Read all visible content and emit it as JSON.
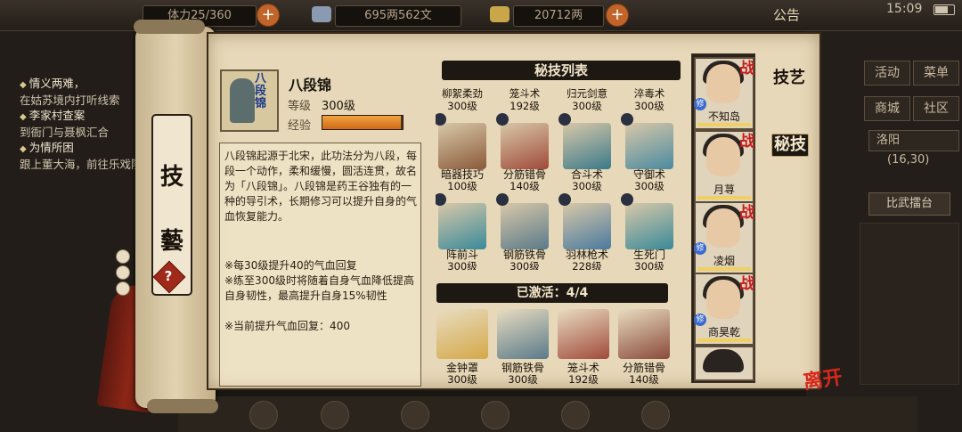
{
  "topbar": {
    "stamina": "体力25/360",
    "silver": "695两562文",
    "gold": "20712两",
    "announcement": "公告",
    "time": "15:09"
  },
  "quests": [
    {
      "title": "情义两难，",
      "desc": "在姑苏境内打听线索"
    },
    {
      "title": "李家村查案",
      "desc": "到衙门与聂枫汇合"
    },
    {
      "title": "为情所困",
      "desc": "跟上董大海，前往乐戏院"
    }
  ],
  "right_menu": {
    "activity": "活动",
    "menu": "菜单",
    "shop": "商城",
    "community": "社区",
    "location": "洛阳",
    "coords": "(16,30)",
    "arena": "比武擂台"
  },
  "scroll": {
    "char1": "技",
    "char2": "藝",
    "help": "?"
  },
  "skill": {
    "portrait_text": "八段锦",
    "name": "八段锦",
    "level_label": "等级",
    "level_value": "300级",
    "exp_label": "经验",
    "exp_fraction": 1.0,
    "description": "八段锦起源于北宋，此功法分为八段，每段一个动作，柔和缓慢，圆活连贯，故名为「八段锦」。八段锦是药王谷独有的一种的导引术，长期修习可以提升自身的气血恢复能力。",
    "note1": "※每30级提升40的气血回复",
    "note2": "※练至300级时将随着自身气血降低提高自身韧性，最高提升自身15%韧性",
    "note3": "※当前提升气血回复：400"
  },
  "list": {
    "title": "秘技列表",
    "partial_top": [
      {
        "name": "柳絮柔劲",
        "level": "300级"
      },
      {
        "name": "笼斗术",
        "level": "192级"
      },
      {
        "name": "归元剑意",
        "level": "300级"
      },
      {
        "name": "淬毒术",
        "level": "300级"
      }
    ],
    "row2": [
      {
        "name": "暗器技巧",
        "level": "100级",
        "color": "#8a5a3a"
      },
      {
        "name": "分筋错骨",
        "level": "140级",
        "color": "#a04a3a"
      },
      {
        "name": "合斗术",
        "level": "300级",
        "color": "#3a7a8a"
      },
      {
        "name": "守御术",
        "level": "300级",
        "color": "#4a8aa0"
      }
    ],
    "row3": [
      {
        "name": "阵前斗",
        "level": "300级",
        "color": "#3a8a9a"
      },
      {
        "name": "钢筋铁骨",
        "level": "300级",
        "color": "#5a7a8a"
      },
      {
        "name": "羽林枪术",
        "level": "228级",
        "color": "#4a7aa0"
      },
      {
        "name": "生死门",
        "level": "300级",
        "color": "#3a8a9a"
      }
    ]
  },
  "active": {
    "label": "已激活：4/4",
    "items": [
      {
        "name": "金钟罩",
        "level": "300级",
        "color": "#d4a848"
      },
      {
        "name": "钢筋铁骨",
        "level": "300级",
        "color": "#5a7a8a"
      },
      {
        "name": "笼斗术",
        "level": "192级",
        "color": "#a04a3a"
      },
      {
        "name": "分筋错骨",
        "level": "140级",
        "color": "#8a4a3a"
      }
    ]
  },
  "characters": [
    {
      "name": "不知岛",
      "badge": "战",
      "tag": "修"
    },
    {
      "name": "月荨",
      "badge": "战",
      "tag": ""
    },
    {
      "name": "凌烟",
      "badge": "战",
      "tag": "修"
    },
    {
      "name": "商昊乾",
      "badge": "战",
      "tag": "修"
    }
  ],
  "tabs": {
    "skills": "技艺",
    "secret": "秘技"
  },
  "leave": "离开",
  "colors": {
    "accent_red": "#c41e1e",
    "exp_orange": "#e8902c",
    "paper": "#e6d8b8"
  }
}
